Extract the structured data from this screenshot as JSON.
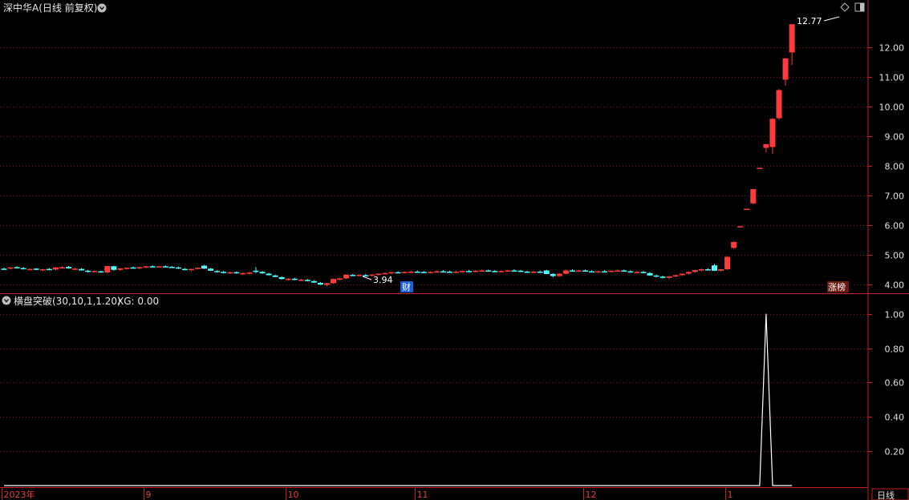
{
  "window": {
    "title": "深中华A(日线 前复权)",
    "indicator_title": "横盘突破(30,10,1,1.20)",
    "indicator_value_label": "XG: 0.00",
    "period_button": "日线"
  },
  "annotations": {
    "high_label": "12.77",
    "low_label": "3.94",
    "badge_cai": "财",
    "badge_zhangbang": "涨榜"
  },
  "colors": {
    "up": "#ff3b3b",
    "down": "#54ffff",
    "grid": "#7a1010",
    "axis": "#c81e1e",
    "indicator_line": "#ffffff",
    "badge_cai_bg": "#1b5fd6",
    "badge_zhangbang_bg": "#6b1a0e"
  },
  "chart_data": [
    {
      "type": "candlestick",
      "title": "深中华A(日线 前复权)",
      "ylim": [
        3.7,
        13.1
      ],
      "y_ticks": [
        "4.00",
        "5.00",
        "6.00",
        "7.00",
        "8.00",
        "9.00",
        "10.00",
        "11.00",
        "12.00"
      ],
      "x_labels": [
        "2023年",
        "9",
        "10",
        "11",
        "12",
        "1"
      ],
      "x_label_index": [
        0,
        22,
        44,
        64,
        90,
        112
      ],
      "candles": [
        [
          4.53,
          4.56,
          4.49,
          4.52
        ],
        [
          4.55,
          4.58,
          4.51,
          4.57
        ],
        [
          4.58,
          4.61,
          4.54,
          4.55
        ],
        [
          4.55,
          4.58,
          4.5,
          4.51
        ],
        [
          4.5,
          4.54,
          4.47,
          4.52
        ],
        [
          4.53,
          4.55,
          4.48,
          4.49
        ],
        [
          4.48,
          4.52,
          4.45,
          4.51
        ],
        [
          4.52,
          4.55,
          4.48,
          4.5
        ],
        [
          4.5,
          4.58,
          4.48,
          4.57
        ],
        [
          4.57,
          4.61,
          4.53,
          4.58
        ],
        [
          4.59,
          4.62,
          4.53,
          4.54
        ],
        [
          4.53,
          4.56,
          4.49,
          4.53
        ],
        [
          4.52,
          4.55,
          4.46,
          4.47
        ],
        [
          4.46,
          4.49,
          4.4,
          4.43
        ],
        [
          4.44,
          4.47,
          4.4,
          4.45
        ],
        [
          4.44,
          4.46,
          4.39,
          4.4
        ],
        [
          4.4,
          4.62,
          4.38,
          4.62
        ],
        [
          4.61,
          4.63,
          4.46,
          4.49
        ],
        [
          4.49,
          4.55,
          4.45,
          4.54
        ],
        [
          4.54,
          4.57,
          4.5,
          4.56
        ],
        [
          4.57,
          4.6,
          4.53,
          4.55
        ],
        [
          4.54,
          4.59,
          4.51,
          4.58
        ],
        [
          4.58,
          4.62,
          4.54,
          4.61
        ],
        [
          4.61,
          4.64,
          4.57,
          4.6
        ],
        [
          4.6,
          4.63,
          4.56,
          4.61
        ],
        [
          4.61,
          4.64,
          4.57,
          4.59
        ],
        [
          4.59,
          4.62,
          4.55,
          4.57
        ],
        [
          4.57,
          4.6,
          4.52,
          4.53
        ],
        [
          4.52,
          4.55,
          4.47,
          4.49
        ],
        [
          4.49,
          4.53,
          4.45,
          4.52
        ],
        [
          4.53,
          4.57,
          4.5,
          4.56
        ],
        [
          4.63,
          4.66,
          4.52,
          4.53
        ],
        [
          4.53,
          4.55,
          4.45,
          4.46
        ],
        [
          4.45,
          4.48,
          4.4,
          4.42
        ],
        [
          4.42,
          4.45,
          4.37,
          4.39
        ],
        [
          4.38,
          4.43,
          4.35,
          4.41
        ],
        [
          4.41,
          4.44,
          4.36,
          4.37
        ],
        [
          4.36,
          4.4,
          4.32,
          4.38
        ],
        [
          4.38,
          4.42,
          4.34,
          4.4
        ],
        [
          4.46,
          4.58,
          4.38,
          4.44
        ],
        [
          4.42,
          4.45,
          4.36,
          4.37
        ],
        [
          4.36,
          4.39,
          4.3,
          4.31
        ],
        [
          4.3,
          4.33,
          4.24,
          4.25
        ],
        [
          4.24,
          4.27,
          4.17,
          4.18
        ],
        [
          4.17,
          4.21,
          4.13,
          4.19
        ],
        [
          4.19,
          4.22,
          4.14,
          4.15
        ],
        [
          4.15,
          4.19,
          4.11,
          4.16
        ],
        [
          4.15,
          4.18,
          4.1,
          4.12
        ],
        [
          4.11,
          4.14,
          4.05,
          4.06
        ],
        [
          4.05,
          4.08,
          3.98,
          3.99
        ],
        [
          3.98,
          4.05,
          3.94,
          4.04
        ],
        [
          4.04,
          4.2,
          4.02,
          4.18
        ],
        [
          4.18,
          4.22,
          4.14,
          4.2
        ],
        [
          4.2,
          4.34,
          4.18,
          4.33
        ],
        [
          4.32,
          4.35,
          4.28,
          4.3
        ],
        [
          4.3,
          4.34,
          4.27,
          4.32
        ],
        [
          4.31,
          4.35,
          4.28,
          4.3
        ],
        [
          4.3,
          4.34,
          4.26,
          4.33
        ],
        [
          4.33,
          4.37,
          4.3,
          4.36
        ],
        [
          4.36,
          4.4,
          4.33,
          4.38
        ],
        [
          4.38,
          4.42,
          4.35,
          4.41
        ],
        [
          4.41,
          4.44,
          4.38,
          4.4
        ],
        [
          4.4,
          4.44,
          4.37,
          4.42
        ],
        [
          4.42,
          4.46,
          4.39,
          4.43
        ],
        [
          4.43,
          4.47,
          4.4,
          4.42
        ],
        [
          4.42,
          4.45,
          4.38,
          4.4
        ],
        [
          4.4,
          4.44,
          4.37,
          4.42
        ],
        [
          4.42,
          4.46,
          4.39,
          4.44
        ],
        [
          4.44,
          4.48,
          4.41,
          4.43
        ],
        [
          4.43,
          4.46,
          4.39,
          4.41
        ],
        [
          4.41,
          4.45,
          4.38,
          4.43
        ],
        [
          4.43,
          4.47,
          4.4,
          4.45
        ],
        [
          4.45,
          4.49,
          4.42,
          4.44
        ],
        [
          4.44,
          4.48,
          4.41,
          4.46
        ],
        [
          4.46,
          4.5,
          4.43,
          4.47
        ],
        [
          4.47,
          4.5,
          4.43,
          4.45
        ],
        [
          4.45,
          4.48,
          4.41,
          4.43
        ],
        [
          4.43,
          4.47,
          4.4,
          4.45
        ],
        [
          4.45,
          4.49,
          4.42,
          4.47
        ],
        [
          4.47,
          4.51,
          4.44,
          4.46
        ],
        [
          4.46,
          4.49,
          4.42,
          4.43
        ],
        [
          4.43,
          4.46,
          4.39,
          4.41
        ],
        [
          4.41,
          4.45,
          4.38,
          4.43
        ],
        [
          4.43,
          4.47,
          4.4,
          4.42
        ],
        [
          4.47,
          4.49,
          4.34,
          4.35
        ],
        [
          4.35,
          4.38,
          4.24,
          4.28
        ],
        [
          4.28,
          4.38,
          4.25,
          4.36
        ],
        [
          4.36,
          4.5,
          4.34,
          4.47
        ],
        [
          4.47,
          4.51,
          4.43,
          4.45
        ],
        [
          4.45,
          4.49,
          4.42,
          4.47
        ],
        [
          4.47,
          4.5,
          4.43,
          4.44
        ],
        [
          4.44,
          4.47,
          4.4,
          4.42
        ],
        [
          4.42,
          4.46,
          4.39,
          4.44
        ],
        [
          4.44,
          4.48,
          4.41,
          4.43
        ],
        [
          4.43,
          4.47,
          4.4,
          4.46
        ],
        [
          4.46,
          4.5,
          4.43,
          4.47
        ],
        [
          4.47,
          4.5,
          4.43,
          4.44
        ],
        [
          4.44,
          4.47,
          4.4,
          4.41
        ],
        [
          4.41,
          4.45,
          4.38,
          4.42
        ],
        [
          4.42,
          4.45,
          4.37,
          4.38
        ],
        [
          4.38,
          4.41,
          4.29,
          4.3
        ],
        [
          4.3,
          4.33,
          4.24,
          4.26
        ],
        [
          4.26,
          4.29,
          4.2,
          4.22
        ],
        [
          4.22,
          4.28,
          4.19,
          4.27
        ],
        [
          4.27,
          4.33,
          4.24,
          4.31
        ],
        [
          4.31,
          4.37,
          4.28,
          4.36
        ],
        [
          4.36,
          4.43,
          4.33,
          4.42
        ],
        [
          4.42,
          4.5,
          4.39,
          4.48
        ],
        [
          4.48,
          4.53,
          4.44,
          4.51
        ],
        [
          4.51,
          4.55,
          4.47,
          4.49
        ],
        [
          4.64,
          4.69,
          4.45,
          4.46
        ],
        [
          4.46,
          4.52,
          4.43,
          4.51
        ],
        [
          4.51,
          4.95,
          4.49,
          4.93
        ],
        [
          5.23,
          5.45,
          5.2,
          5.43
        ],
        [
          5.93,
          5.96,
          5.93,
          5.96
        ],
        [
          6.55,
          6.55,
          6.55,
          6.55
        ],
        [
          6.73,
          7.21,
          6.7,
          7.21
        ],
        [
          7.93,
          7.93,
          7.93,
          7.93
        ],
        [
          8.6,
          8.73,
          8.45,
          8.73
        ],
        [
          8.63,
          9.61,
          8.4,
          9.58
        ],
        [
          9.6,
          10.58,
          9.55,
          10.55
        ],
        [
          10.9,
          11.63,
          10.7,
          11.62
        ],
        [
          11.82,
          12.77,
          11.4,
          12.77
        ]
      ]
    },
    {
      "type": "line",
      "title": "横盘突破(30,10,1,1.20)",
      "ylim": [
        0.0,
        1.05
      ],
      "y_ticks": [
        "0.20",
        "0.40",
        "0.60",
        "0.80",
        "1.00"
      ],
      "signal_index": 118,
      "signal_value": 1.0,
      "baseline_value": 0.0
    }
  ]
}
